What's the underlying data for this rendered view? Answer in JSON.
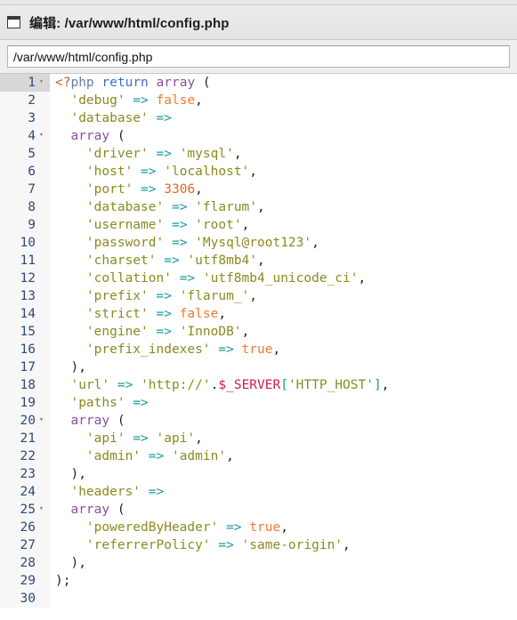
{
  "window": {
    "icon": "window-icon",
    "title": "编辑: /var/www/html/config.php"
  },
  "path_bar": {
    "value": "/var/www/html/config.php",
    "placeholder": "/var/www/html/config.php"
  },
  "editor": {
    "language": "php",
    "active_line": 1,
    "total_lines": 30,
    "fold_lines": [
      1,
      4,
      20,
      25
    ],
    "colors": {
      "background": "#ffffff",
      "gutter_background": "#f7f7f7",
      "gutter_active": "#d8d8d8",
      "line_number": "#2e4a78",
      "string": "#8a8a20",
      "operator": "#1a9a9a",
      "number": "#e06a28",
      "constant": "#f07a30",
      "keyword": "#3b6fd4",
      "function": "#8a4fa8",
      "variable": "#d01c4b",
      "open_tag": "#b06020",
      "punctuation": "#2b2b2b"
    },
    "lines": [
      {
        "n": 1,
        "fold": true,
        "text": "<?php return array ("
      },
      {
        "n": 2,
        "fold": false,
        "text": "  'debug' => false,"
      },
      {
        "n": 3,
        "fold": false,
        "text": "  'database' =>"
      },
      {
        "n": 4,
        "fold": true,
        "text": "  array ("
      },
      {
        "n": 5,
        "fold": false,
        "text": "    'driver' => 'mysql',"
      },
      {
        "n": 6,
        "fold": false,
        "text": "    'host' => 'localhost',"
      },
      {
        "n": 7,
        "fold": false,
        "text": "    'port' => 3306,"
      },
      {
        "n": 8,
        "fold": false,
        "text": "    'database' => 'flarum',"
      },
      {
        "n": 9,
        "fold": false,
        "text": "    'username' => 'root',"
      },
      {
        "n": 10,
        "fold": false,
        "text": "    'password' => 'Mysql@root123',"
      },
      {
        "n": 11,
        "fold": false,
        "text": "    'charset' => 'utf8mb4',"
      },
      {
        "n": 12,
        "fold": false,
        "text": "    'collation' => 'utf8mb4_unicode_ci',"
      },
      {
        "n": 13,
        "fold": false,
        "text": "    'prefix' => 'flarum_',"
      },
      {
        "n": 14,
        "fold": false,
        "text": "    'strict' => false,"
      },
      {
        "n": 15,
        "fold": false,
        "text": "    'engine' => 'InnoDB',"
      },
      {
        "n": 16,
        "fold": false,
        "text": "    'prefix_indexes' => true,"
      },
      {
        "n": 17,
        "fold": false,
        "text": "  ),"
      },
      {
        "n": 18,
        "fold": false,
        "text": "  'url' => 'http://'.$_SERVER['HTTP_HOST'],"
      },
      {
        "n": 19,
        "fold": false,
        "text": "  'paths' =>"
      },
      {
        "n": 20,
        "fold": true,
        "text": "  array ("
      },
      {
        "n": 21,
        "fold": false,
        "text": "    'api' => 'api',"
      },
      {
        "n": 22,
        "fold": false,
        "text": "    'admin' => 'admin',"
      },
      {
        "n": 23,
        "fold": false,
        "text": "  ),"
      },
      {
        "n": 24,
        "fold": false,
        "text": "  'headers' =>"
      },
      {
        "n": 25,
        "fold": true,
        "text": "  array ("
      },
      {
        "n": 26,
        "fold": false,
        "text": "    'poweredByHeader' => true,"
      },
      {
        "n": 27,
        "fold": false,
        "text": "    'referrerPolicy' => 'same-origin',"
      },
      {
        "n": 28,
        "fold": false,
        "text": "  ),"
      },
      {
        "n": 29,
        "fold": false,
        "text": ");"
      },
      {
        "n": 30,
        "fold": false,
        "text": ""
      }
    ]
  },
  "icons": {
    "fold_arrow": "▾"
  }
}
